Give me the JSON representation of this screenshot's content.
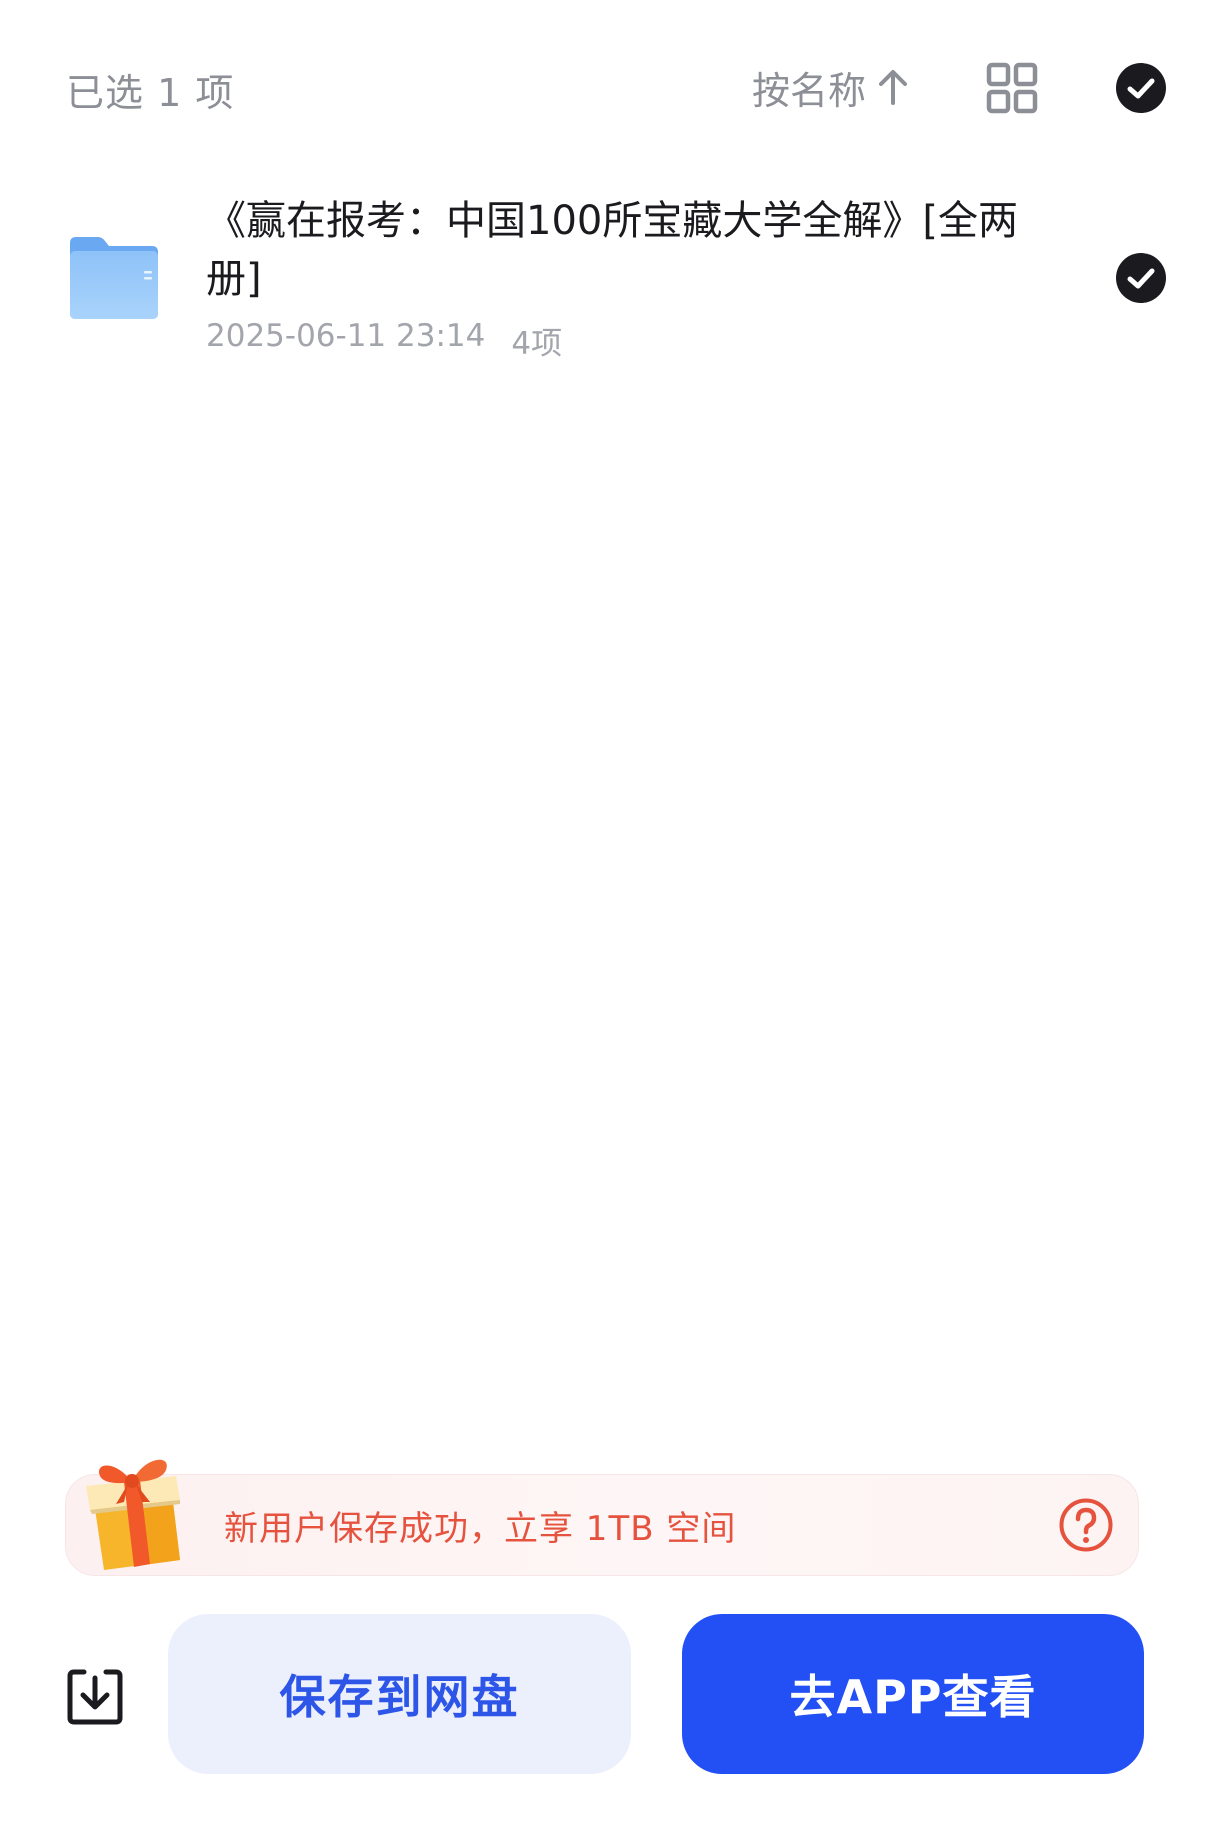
{
  "header": {
    "selected_count_text": "已选 1 项",
    "sort_label": "按名称",
    "icons": {
      "sort_direction": "arrow-up-icon",
      "view_toggle": "grid-icon",
      "select_all": "check-circle-icon"
    }
  },
  "files": [
    {
      "name": "《赢在报考：中国100所宝藏大学全解》[全两册]",
      "modified": "2025-06-11 23:14",
      "item_count": "4项",
      "selected": true,
      "icon": "folder-icon"
    }
  ],
  "promo": {
    "text": "新用户保存成功，立享 1TB 空间",
    "icons": {
      "gift": "gift-icon",
      "help": "question-circle-icon"
    }
  },
  "actions": {
    "download_icon": "download-icon",
    "save_label": "保存到网盘",
    "open_app_label": "去APP查看"
  },
  "colors": {
    "accent_blue": "#2350f5",
    "save_button_bg": "#ecf0fc",
    "save_button_text": "#2d55e8",
    "promo_text": "#e5533f",
    "muted_text": "#8d8f96",
    "check_fill": "#1b1b1f"
  }
}
